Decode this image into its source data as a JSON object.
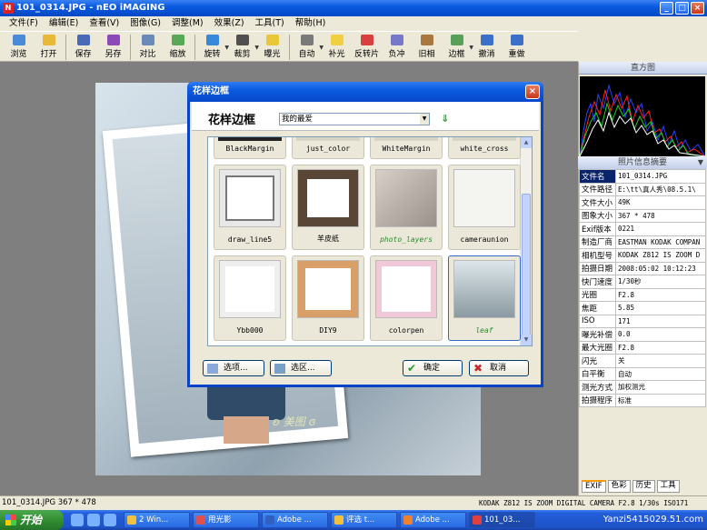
{
  "window": {
    "title": "101_0314.JPG - nEO iMAGING"
  },
  "menu": [
    "文件(F)",
    "编辑(E)",
    "查看(V)",
    "图像(G)",
    "调整(M)",
    "效果(Z)",
    "工具(T)",
    "帮助(H)"
  ],
  "toolbar": [
    {
      "label": "浏览",
      "icon": "browse-icon",
      "color": "#4a8ad8"
    },
    {
      "label": "打开",
      "icon": "open-folder-icon",
      "color": "#e8b838"
    },
    {
      "label": "保存",
      "icon": "save-icon",
      "color": "#4a6ab8"
    },
    {
      "label": "另存",
      "icon": "save-as-icon",
      "color": "#8a4ab8"
    },
    {
      "label": "对比",
      "icon": "compare-icon",
      "color": "#6a8ab8"
    },
    {
      "label": "缩放",
      "icon": "zoom-icon",
      "color": "#58a858"
    },
    {
      "label": "旋转",
      "icon": "rotate-icon",
      "color": "#3a88d8"
    },
    {
      "label": "裁剪",
      "icon": "crop-icon",
      "color": "#505050"
    },
    {
      "label": "曝光",
      "icon": "exposure-icon",
      "color": "#e8c838"
    },
    {
      "label": "自动",
      "icon": "auto-icon",
      "color": "#7a7a7a"
    },
    {
      "label": "补光",
      "icon": "fill-light-icon",
      "color": "#f0d040"
    },
    {
      "label": "反转片",
      "icon": "reversal-film-icon",
      "color": "#d84040"
    },
    {
      "label": "负冲",
      "icon": "cross-process-icon",
      "color": "#7878c8"
    },
    {
      "label": "旧相",
      "icon": "old-photo-icon",
      "color": "#a87840"
    },
    {
      "label": "边框",
      "icon": "frame-icon",
      "color": "#58a058"
    },
    {
      "label": "撤消",
      "icon": "undo-icon",
      "color": "#3a70c8"
    },
    {
      "label": "重做",
      "icon": "redo-icon",
      "color": "#3a70c8"
    }
  ],
  "canvas": {
    "watermark": "ʚ 美图 ɞ"
  },
  "histogram": {
    "title": "直方图"
  },
  "info": {
    "title": "照片信息摘要",
    "rows": [
      {
        "k": "文件名",
        "v": "101_0314.JPG"
      },
      {
        "k": "文件路径",
        "v": "E:\\tt\\真人秀\\08.5.1\\"
      },
      {
        "k": "文件大小",
        "v": "49K"
      },
      {
        "k": "图象大小",
        "v": "367 * 478"
      },
      {
        "k": "Exif版本",
        "v": "0221"
      },
      {
        "k": "制造厂商",
        "v": "EASTMAN KODAK COMPAN"
      },
      {
        "k": "相机型号",
        "v": "KODAK Z812 IS ZOOM D"
      },
      {
        "k": "拍摄日期",
        "v": "2008:05:02 10:12:23"
      },
      {
        "k": "快门速度",
        "v": "1/30秒"
      },
      {
        "k": "光圈",
        "v": "F2.8"
      },
      {
        "k": "焦距",
        "v": "5.85"
      },
      {
        "k": "ISO",
        "v": "171"
      },
      {
        "k": "曝光补偿",
        "v": "0.0"
      },
      {
        "k": "最大光圈",
        "v": "F2.8"
      },
      {
        "k": "闪光",
        "v": "关"
      },
      {
        "k": "白平衡",
        "v": "自动"
      },
      {
        "k": "测光方式",
        "v": "加权测光"
      },
      {
        "k": "拍摄程序",
        "v": "标准"
      }
    ],
    "tabs": [
      "EXIF",
      "色彩",
      "历史",
      "工具"
    ]
  },
  "dialog": {
    "title": "花样边框",
    "heading": "花样边框",
    "category": "我的最爱",
    "top_row": [
      "BlackMargin",
      "just_color",
      "WhiteMargin",
      "white_cross"
    ],
    "items": [
      {
        "label": "draw_line5",
        "green": false
      },
      {
        "label": "羊皮纸",
        "green": false
      },
      {
        "label": "photo_layers",
        "green": true
      },
      {
        "label": "cameraunion",
        "green": false
      },
      {
        "label": "Ybb000",
        "green": false
      },
      {
        "label": "DIY9",
        "green": false
      },
      {
        "label": "colorpen",
        "green": false
      },
      {
        "label": "leaf",
        "green": true
      }
    ],
    "options_button": "选项...",
    "select_area_button": "选区...",
    "ok_button": "确定",
    "cancel_button": "取消"
  },
  "status": {
    "left": "101_0314.JPG 367 * 478",
    "right": "KODAK Z812 IS ZOOM DIGITAL CAMERA F2.8 1/30s ISO171"
  },
  "taskbar": {
    "start": "开始",
    "tasks": [
      "2 Win...",
      "用光影",
      "Adobe ...",
      "评选 t...",
      "Adobe ...",
      "101_03..."
    ],
    "watermark": "Yanzi5415029.51.com"
  }
}
